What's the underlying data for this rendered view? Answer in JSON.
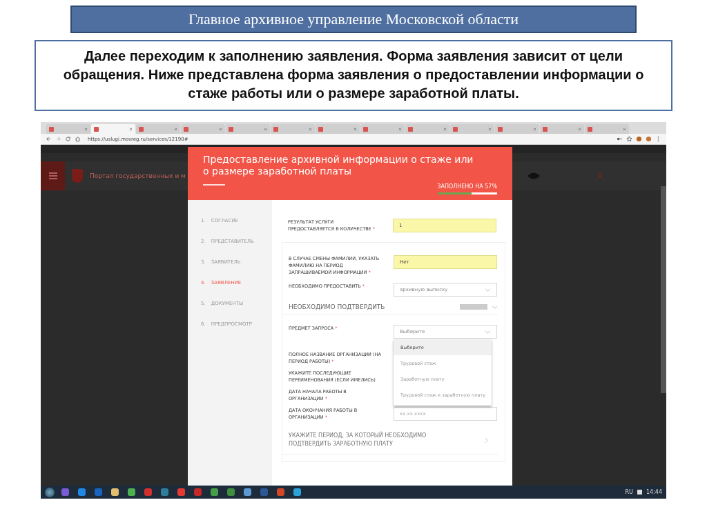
{
  "slide": {
    "title": "Главное архивное управление Московской области",
    "intro": "Далее переходим к заполнению заявления. Форма заявления зависит от цели обращения. Ниже представлена форма заявления о предоставлении информации о стаже работы или о размере заработной платы."
  },
  "browser": {
    "tabs": [
      {
        "selected": false
      },
      {
        "selected": true
      },
      {
        "selected": false
      },
      {
        "selected": false
      },
      {
        "selected": false
      },
      {
        "selected": false
      },
      {
        "selected": false
      },
      {
        "selected": false
      },
      {
        "selected": false
      },
      {
        "selected": false
      },
      {
        "selected": false
      },
      {
        "selected": false
      },
      {
        "selected": false
      }
    ],
    "address": "https://uslugi.mosreg.ru/services/12190#"
  },
  "site_header": {
    "site_name": "Портал государственных и м"
  },
  "form": {
    "title": "Предоставление архивной информации о стаже или о размере заработной платы",
    "progress": {
      "label": "ЗАПОЛНЕНО НА 57%",
      "level": 0.57
    },
    "steps": [
      {
        "number": "1.",
        "label": "СОГЛАСИЕ",
        "selected": false
      },
      {
        "number": "2.",
        "label": "ПРЕДСТАВИТЕЛЬ",
        "selected": false
      },
      {
        "number": "3.",
        "label": "ЗАЯВИТЕЛЬ",
        "selected": false
      },
      {
        "number": "4.",
        "label": "ЗАЯВЛЕНИЕ",
        "selected": true
      },
      {
        "number": "5.",
        "label": "ДОКУМЕНТЫ",
        "selected": false
      },
      {
        "number": "6.",
        "label": "ПРЕДПРОСМОТР",
        "selected": false
      }
    ],
    "top_field": {
      "label": "РЕЗУЛЬТАТ УСЛУГИ ПРЕДОСТАВЛЯЕТСЯ В КОЛИЧЕСТВЕ",
      "mark": "*",
      "value": "1",
      "highlighted": true
    },
    "fields": [
      {
        "kind": "input",
        "label": "В СЛУЧАЕ СМЕНЫ ФАМИЛИИ, УКАЗАТЬ ФАМИЛИЮ НА ПЕРИОД ЗАПРАШИВАЕМОЙ ИНФОРМАЦИИ",
        "mark": "*",
        "value": "Нет",
        "highlighted": true
      },
      {
        "kind": "select",
        "label": "НЕОБХОДИМО ПРЕДОСТАВИТЬ",
        "mark": "*",
        "value": "архивную выписку"
      },
      {
        "kind": "section",
        "title": "НЕОБХОДИМО ПОДТВЕРДИТЬ"
      },
      {
        "kind": "dropdown",
        "label": "ПРЕДМЕТ ЗАПРОСА",
        "mark": "*",
        "placeholder": "Выберите",
        "options": [
          {
            "label": "Выберите",
            "selected": true
          },
          {
            "label": "Трудовой стаж",
            "selected": false
          },
          {
            "label": "Заработную плату",
            "selected": false
          },
          {
            "label": "Трудовой стаж и заработную плату",
            "selected": false
          }
        ]
      },
      {
        "kind": "covered",
        "label": "ПОЛНОЕ НАЗВАНИЕ ОРГАНИЗАЦИИ (НА ПЕРИОД РАБОТЫ)",
        "mark": "*"
      },
      {
        "kind": "covered",
        "label": "УКАЖИТЕ ПОСЛЕДУЮЩИЕ ПЕРЕИМЕНОВАНИЯ (ЕСЛИ ИМЕЛИСЬ)"
      },
      {
        "kind": "covered",
        "label": "ДАТА НАЧАЛА РАБОТЫ В ОРГАНИЗАЦИИ",
        "mark": "*"
      },
      {
        "kind": "input",
        "label": "ДАТА ОКОНЧАНИЯ РАБОТЫ В ОРГАНИЗАЦИИ",
        "mark": "*",
        "placeholder": "xx.xx.xxxx",
        "highlighted": false
      },
      {
        "kind": "link",
        "title": "УКАЖИТЕ ПЕРИОД, ЗА КОТОРЫЙ НЕОБХОДИМО ПОДТВЕРДИТЬ ЗАРАБОТНУЮ ПЛАТУ"
      }
    ]
  },
  "taskbar": {
    "language": "RU",
    "time": "14:44"
  }
}
